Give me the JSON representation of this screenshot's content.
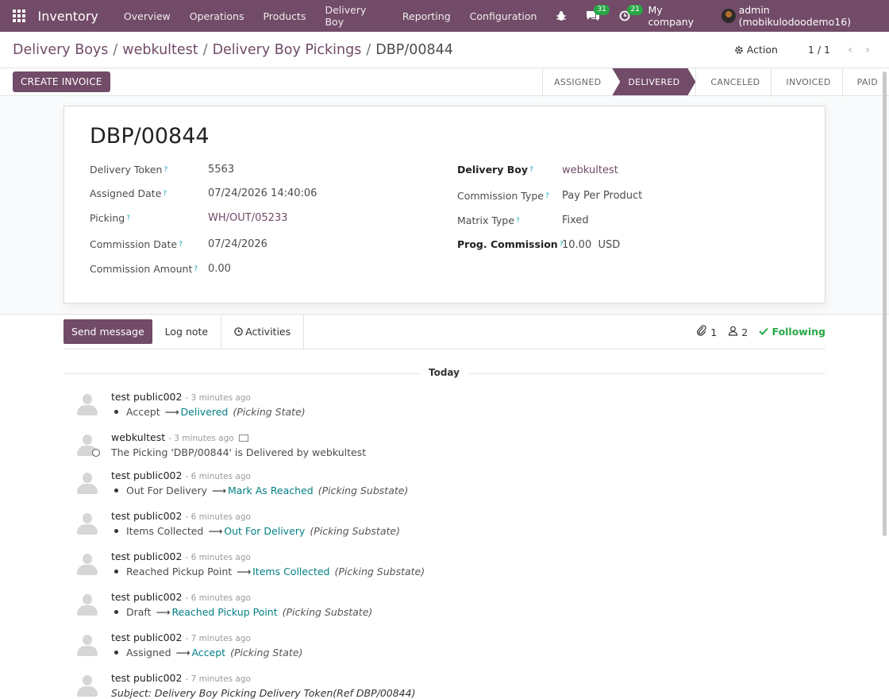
{
  "navbar": {
    "app_name": "Inventory",
    "menu": [
      "Overview",
      "Operations",
      "Products",
      "Delivery Boy",
      "Reporting",
      "Configuration"
    ],
    "messages_count": "31",
    "activities_count": "21",
    "company": "My company",
    "user": "admin (mobikulodoodemo16)"
  },
  "breadcrumb": {
    "items": [
      "Delivery Boys",
      "webkultest",
      "Delivery Boy Pickings"
    ],
    "current": "DBP/00844"
  },
  "controls": {
    "action_label": "Action",
    "pager": "1 / 1"
  },
  "statusbar": {
    "create_invoice_label": "CREATE INVOICE",
    "stages": [
      "ASSIGNED",
      "DELIVERED",
      "CANCELED",
      "INVOICED",
      "PAID"
    ],
    "active_stage": "DELIVERED"
  },
  "record": {
    "title": "DBP/00844",
    "left_fields": [
      {
        "label": "Delivery Token",
        "value": "5563"
      },
      {
        "label": "Assigned Date",
        "value": "07/24/2026 14:40:06"
      },
      {
        "label": "Picking",
        "value": "WH/OUT/05233"
      },
      {
        "label": "Commission Date",
        "value": "07/24/2026"
      },
      {
        "label": "Commission Amount",
        "value": "0.00"
      }
    ],
    "right_fields": [
      {
        "label": "Delivery Boy",
        "value": "webkultest"
      },
      {
        "label": "Commission Type",
        "value": "Pay Per Product"
      },
      {
        "label": "Matrix Type",
        "value": "Fixed"
      },
      {
        "label": "Prog. Commission",
        "value": "10.00",
        "currency": "USD"
      }
    ]
  },
  "chatter": {
    "send_message_label": "Send message",
    "log_note_label": "Log note",
    "activities_label": "Activities",
    "attachments_count": "1",
    "followers_count": "2",
    "following_label": "Following",
    "today_label": "Today",
    "messages": [
      {
        "author": "test public002",
        "when": "- 3 minutes ago",
        "old": "Accept",
        "new": "Delivered",
        "field": "(Picking State)"
      },
      {
        "author": "webkultest",
        "when": "- 3 minutes ago",
        "text": "The Picking 'DBP/00844' is Delivered by webkultest"
      },
      {
        "author": "test public002",
        "when": "- 6 minutes ago",
        "old": "Out For Delivery",
        "new": "Mark As Reached",
        "field": "(Picking Substate)"
      },
      {
        "author": "test public002",
        "when": "- 6 minutes ago",
        "old": "Items Collected",
        "new": "Out For Delivery",
        "field": "(Picking Substate)"
      },
      {
        "author": "test public002",
        "when": "- 6 minutes ago",
        "old": "Reached Pickup Point",
        "new": "Items Collected",
        "field": "(Picking Substate)"
      },
      {
        "author": "test public002",
        "when": "- 6 minutes ago",
        "old": "Draft",
        "new": "Reached Pickup Point",
        "field": "(Picking Substate)"
      },
      {
        "author": "test public002",
        "when": "- 7 minutes ago",
        "old": "Assigned",
        "new": "Accept",
        "field": "(Picking State)"
      },
      {
        "author": "test public002",
        "when": "- 7 minutes ago",
        "subject": "Subject: Delivery Boy Picking Delivery Token(Ref DBP/00844)"
      }
    ]
  }
}
